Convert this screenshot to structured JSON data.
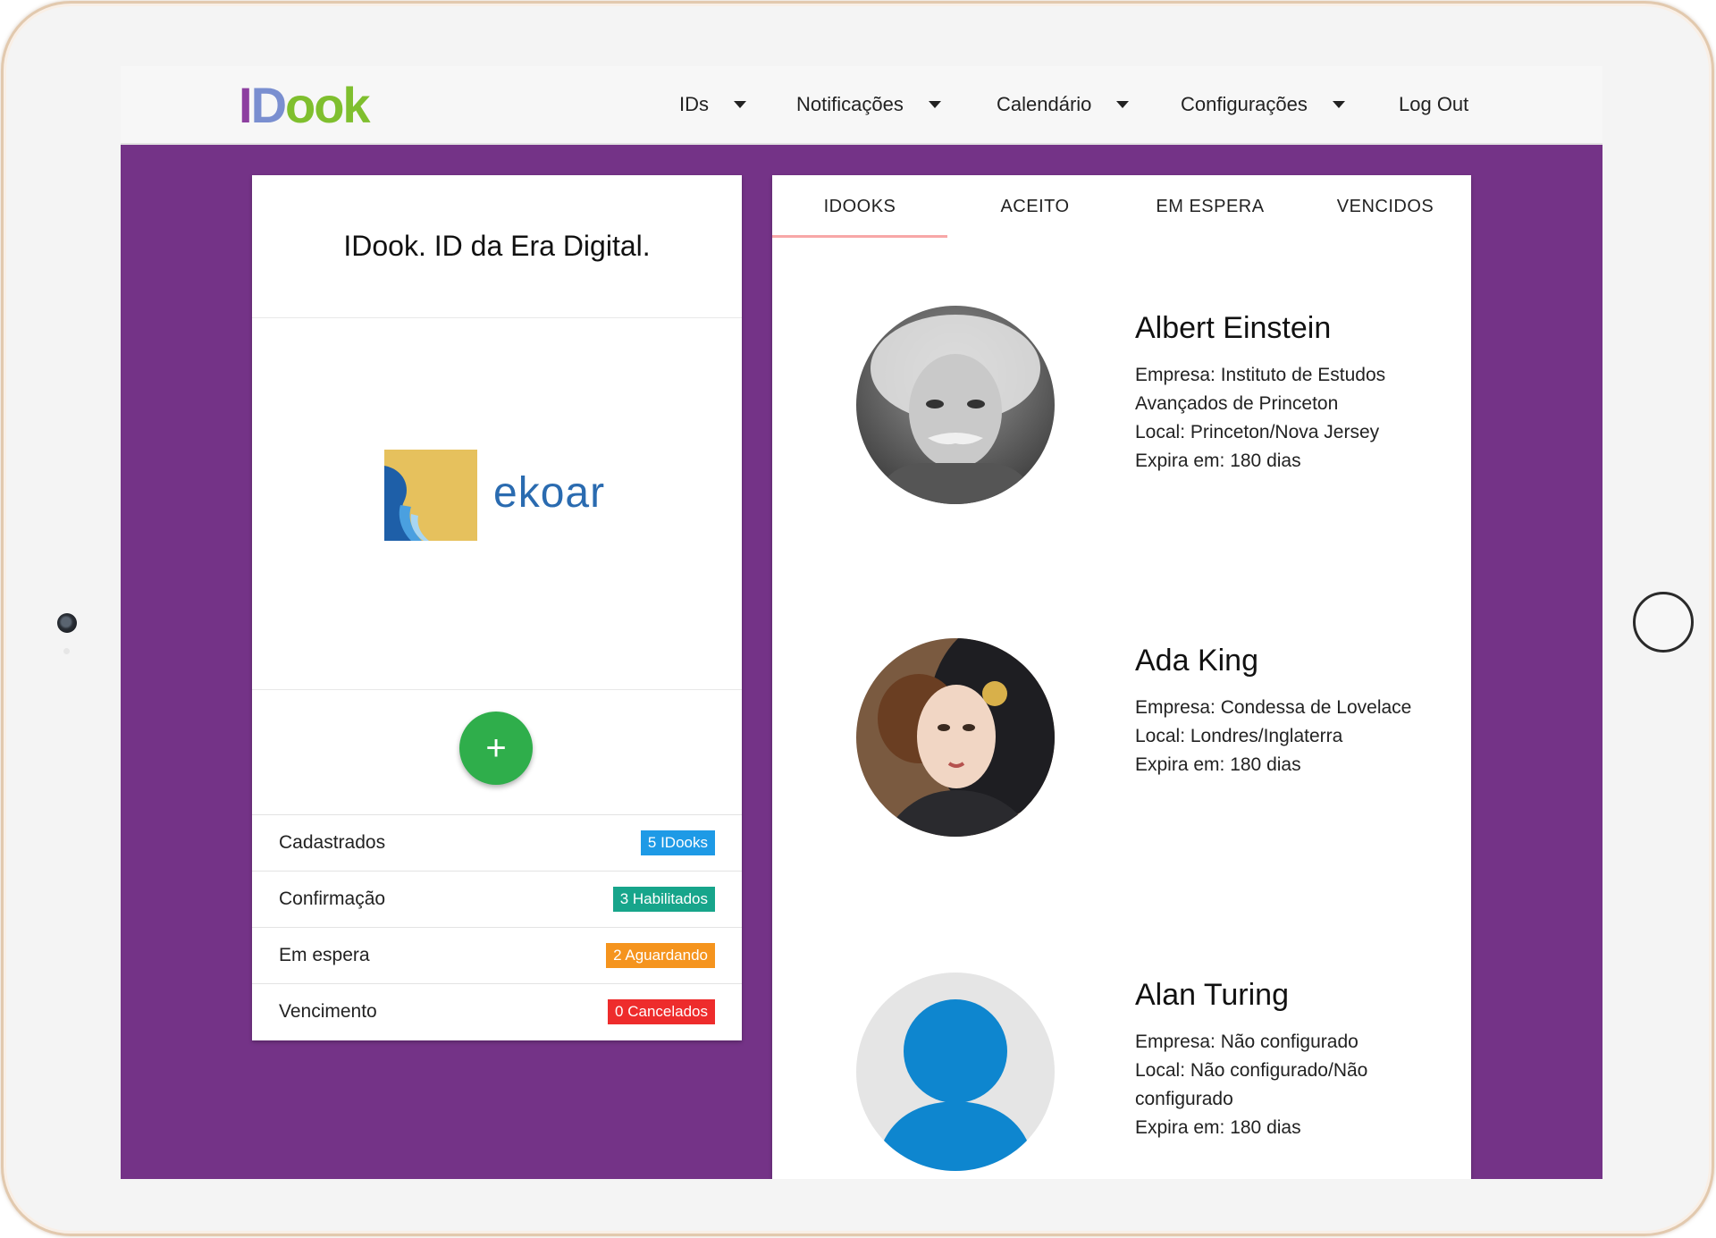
{
  "app": {
    "logo": {
      "i": "I",
      "d": "D",
      "ook": "ook"
    }
  },
  "nav": {
    "items": [
      {
        "label": "IDs",
        "dropdown": true
      },
      {
        "label": "Notificações",
        "dropdown": true
      },
      {
        "label": "Calendário",
        "dropdown": true
      },
      {
        "label": "Configurações",
        "dropdown": true
      },
      {
        "label": "Log Out",
        "dropdown": false
      }
    ]
  },
  "left_card": {
    "title": "IDook. ID da Era Digital.",
    "brand": {
      "name": "ekoar",
      "colors": {
        "square": "#e6c15d",
        "wing": "#1e5fa8",
        "text": "#2a6bb0"
      }
    },
    "add_button": "+",
    "stats": [
      {
        "label": "Cadastrados",
        "badge": "5 IDooks",
        "color": "#1e9ae6"
      },
      {
        "label": "Confirmação",
        "badge": "3 Habilitados",
        "color": "#17a58b"
      },
      {
        "label": "Em espera",
        "badge": "2 Aguardando",
        "color": "#f5941e"
      },
      {
        "label": "Vencimento",
        "badge": "0 Cancelados",
        "color": "#ee2c2c"
      }
    ]
  },
  "right_card": {
    "tabs": [
      {
        "label": "IDOOKS",
        "active": true
      },
      {
        "label": "ACEITO",
        "active": false
      },
      {
        "label": "EM ESPERA",
        "active": false
      },
      {
        "label": "VENCIDOS",
        "active": false
      }
    ],
    "people": [
      {
        "name": "Albert Einstein",
        "lines": [
          "Empresa: Instituto de Estudos Avançados de Princeton",
          "Local: Princeton/Nova Jersey",
          "Expira em: 180 dias"
        ],
        "avatar": "photo-grayscale-portrait"
      },
      {
        "name": "Ada King",
        "lines": [
          "Empresa: Condessa de Lovelace",
          "Local: Londres/Inglaterra",
          "Expira em: 180 dias"
        ],
        "avatar": "painted-portrait"
      },
      {
        "name": "Alan Turing",
        "lines": [
          "Empresa: Não configurado",
          "Local: Não configurado/Não configurado",
          "Expira em: 180 dias"
        ],
        "avatar": "default-user-icon"
      }
    ]
  },
  "colors": {
    "page_background": "#743387",
    "navbar": "#f7f7f7",
    "tab_indicator": "#f7a7a7",
    "fab": "#2fae4b",
    "default_avatar": "#0e86cf"
  }
}
